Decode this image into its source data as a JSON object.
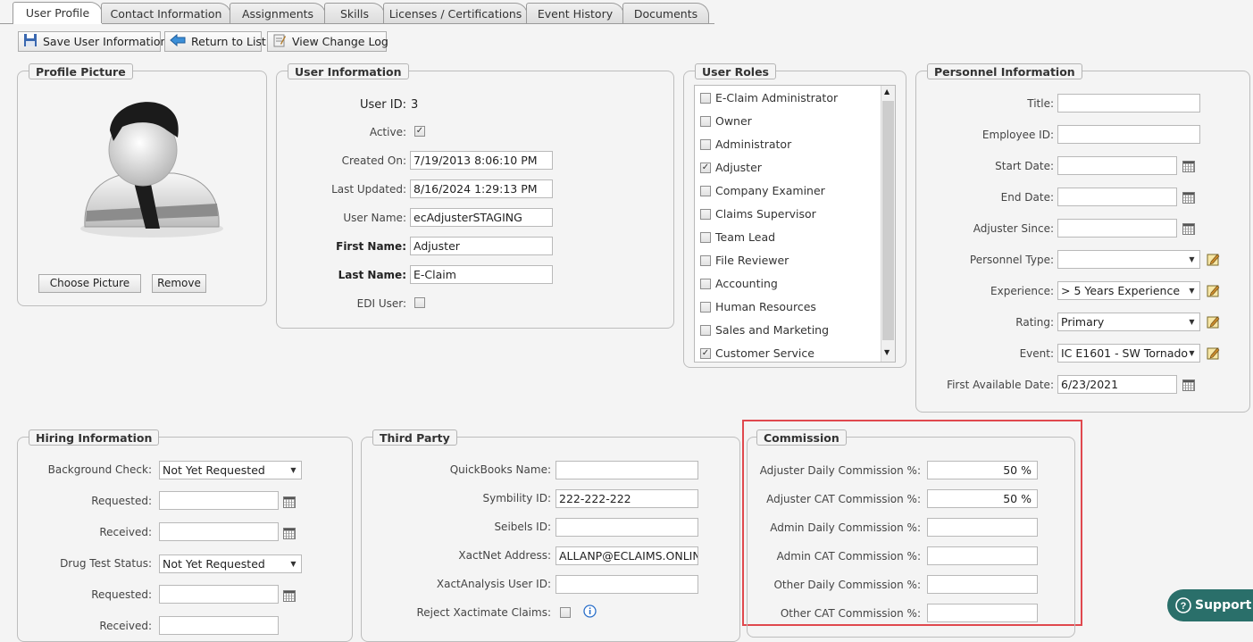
{
  "tabs": [
    "User Profile",
    "Contact Information",
    "Assignments",
    "Skills",
    "Licenses / Certifications",
    "Event History",
    "Documents"
  ],
  "toolbar": {
    "save": "Save User Information",
    "return": "Return to List",
    "log": "View Change Log"
  },
  "profile_picture": {
    "legend": "Profile Picture",
    "choose": "Choose Picture",
    "remove": "Remove"
  },
  "user_info": {
    "legend": "User Information",
    "user_id_label": "User ID:",
    "user_id": "3",
    "active_label": "Active:",
    "active": true,
    "created_label": "Created On:",
    "created": "7/19/2013 8:06:10 PM",
    "updated_label": "Last Updated:",
    "updated": "8/16/2024 1:29:13 PM",
    "username_label": "User Name:",
    "username": "ecAdjusterSTAGING",
    "firstname_label": "First Name:",
    "firstname": "Adjuster",
    "lastname_label": "Last Name:",
    "lastname": "E-Claim",
    "edi_label": "EDI User:",
    "edi": false
  },
  "user_roles": {
    "legend": "User Roles",
    "items": [
      {
        "label": "E-Claim Administrator",
        "checked": false
      },
      {
        "label": "Owner",
        "checked": false
      },
      {
        "label": "Administrator",
        "checked": false
      },
      {
        "label": "Adjuster",
        "checked": true
      },
      {
        "label": "Company Examiner",
        "checked": false
      },
      {
        "label": "Claims Supervisor",
        "checked": false
      },
      {
        "label": "Team Lead",
        "checked": false
      },
      {
        "label": "File Reviewer",
        "checked": false
      },
      {
        "label": "Accounting",
        "checked": false
      },
      {
        "label": "Human Resources",
        "checked": false
      },
      {
        "label": "Sales and Marketing",
        "checked": false
      },
      {
        "label": "Customer Service",
        "checked": true
      }
    ]
  },
  "personnel": {
    "legend": "Personnel Information",
    "title_label": "Title:",
    "title": "",
    "empid_label": "Employee ID:",
    "empid": "",
    "start_label": "Start Date:",
    "start": "",
    "end_label": "End Date:",
    "end": "",
    "since_label": "Adjuster Since:",
    "since": "",
    "type_label": "Personnel Type:",
    "type": "",
    "exp_label": "Experience:",
    "exp": "> 5 Years Experience",
    "rating_label": "Rating:",
    "rating": "Primary",
    "event_label": "Event:",
    "event": "IC E1601 - SW Tornado",
    "first_avail_label": "First Available Date:",
    "first_avail": "6/23/2021"
  },
  "hiring": {
    "legend": "Hiring Information",
    "bg_label": "Background Check:",
    "bg": "Not Yet Requested",
    "req1_label": "Requested:",
    "req1": "",
    "rec1_label": "Received:",
    "rec1": "",
    "drug_label": "Drug Test Status:",
    "drug": "Not Yet Requested",
    "req2_label": "Requested:",
    "req2": "",
    "rec2_label": "Received:",
    "rec2": ""
  },
  "third_party": {
    "legend": "Third Party",
    "qb_label": "QuickBooks Name:",
    "qb": "",
    "sym_label": "Symbility ID:",
    "sym": "222-222-222",
    "seibels_label": "Seibels ID:",
    "seibels": "",
    "xact_label": "XactNet Address:",
    "xact": "ALLANP@ECLAIMS.ONLINE.T",
    "xa_label": "XactAnalysis User ID:",
    "xa": "",
    "reject_label": "Reject Xactimate Claims:",
    "reject": false
  },
  "commission": {
    "legend": "Commission",
    "adj_daily_label": "Adjuster Daily Commission %:",
    "adj_daily": "50 %",
    "adj_cat_label": "Adjuster CAT Commission %:",
    "adj_cat": "50 %",
    "admin_daily_label": "Admin Daily Commission %:",
    "admin_daily": "",
    "admin_cat_label": "Admin CAT Commission %:",
    "admin_cat": "",
    "other_daily_label": "Other Daily Commission %:",
    "other_daily": "",
    "other_cat_label": "Other CAT Commission %:",
    "other_cat": ""
  },
  "support": {
    "label": "Support"
  },
  "colors": {
    "highlight": "#e0484e",
    "support_bg": "#2a6f6a"
  }
}
